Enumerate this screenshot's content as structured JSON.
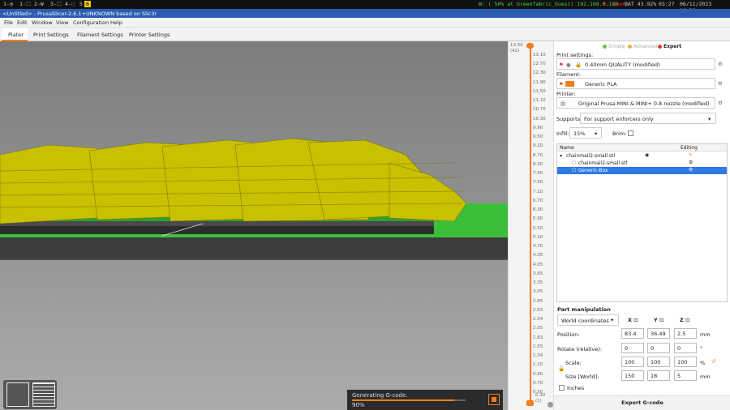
{
  "sysbar": {
    "workspaces": [
      "1-◔",
      "1-🗀",
      "2-W",
      "3-🗀",
      "4-⬚",
      "5",
      "6"
    ],
    "wifi": "W: ( 50% at Greenfabric_Guest) 192.168.0.160",
    "eth": "E: down",
    "battery": "BAT 43.92%",
    "clock": "03:27",
    "date": "06/11/2023 16:30"
  },
  "window_title": "<Untitled> - PrusaSlicer-2.6.1+UNKNOWN based on Slic3r",
  "menu": [
    "File",
    "Edit",
    "Window",
    "View",
    "Configuration",
    "Help"
  ],
  "tabs": [
    "Plater",
    "Print Settings",
    "Filament Settings",
    "Printer Settings"
  ],
  "ruler": {
    "top": "13.50",
    "top_sub": "(42)",
    "ticks": [
      "13.10",
      "12.70",
      "12.30",
      "11.90",
      "11.50",
      "11.10",
      "10.70",
      "10.30",
      "9.90",
      "9.50",
      "9.10",
      "8.70",
      "8.30",
      "7.90",
      "7.50",
      "7.10",
      "6.70",
      "6.30",
      "5.90",
      "5.50",
      "5.10",
      "4.70",
      "4.35",
      "4.05",
      "3.65",
      "3.35",
      "3.05",
      "2.85",
      "2.55",
      "2.34",
      "2.05",
      "1.83",
      "1.55",
      "1.34",
      "1.10",
      "0.90",
      "0.70",
      "0.50"
    ],
    "bottom": "0.30",
    "bottom_sub": "(1)"
  },
  "progress": {
    "label": "Generating G-code.",
    "percent_text": "90%",
    "fraction": 0.9
  },
  "modes": [
    "Simple",
    "Advanced",
    "Expert"
  ],
  "mode_colors": [
    "#6bc24a",
    "#e3b13a",
    "#d83b2d"
  ],
  "accent": "#f07e1b",
  "print_settings": {
    "label": "Print settings:",
    "value": "0.40mm QUALITY (modified)"
  },
  "filament": {
    "label": "Filament:",
    "value": "Generic PLA"
  },
  "printer": {
    "label": "Printer:",
    "value": "Original Prusa MINI & MINI+ 0.8 nozzle (modified)"
  },
  "supports": {
    "label": "Supports:",
    "value": "For support enforcers only"
  },
  "infill": {
    "label": "Infill:",
    "value": "15%"
  },
  "brim": {
    "label": "Brim:"
  },
  "objects": {
    "col_name": "Name",
    "col_edit": "Editing",
    "rows": [
      "chainmail2-small.stl",
      "chainmail2-small.stl",
      "Generic-Box"
    ]
  },
  "part": {
    "title": "Part manipulation",
    "coords": "World coordinates",
    "x": "X",
    "y": "Y",
    "z": "Z",
    "position_label": "Position:",
    "position": [
      "83.4",
      "36.49",
      "2.5"
    ],
    "rotate_label": "Rotate (relative):",
    "rotate": [
      "0",
      "0",
      "0"
    ],
    "scale_label": "Scale:",
    "scale": [
      "100",
      "100",
      "100"
    ],
    "size_label": "Size [World]:",
    "size": [
      "150",
      "18",
      "5"
    ],
    "unit_mm": "mm",
    "unit_deg": "°",
    "unit_pct": "%",
    "inches": "Inches"
  },
  "export": "Export G-code"
}
